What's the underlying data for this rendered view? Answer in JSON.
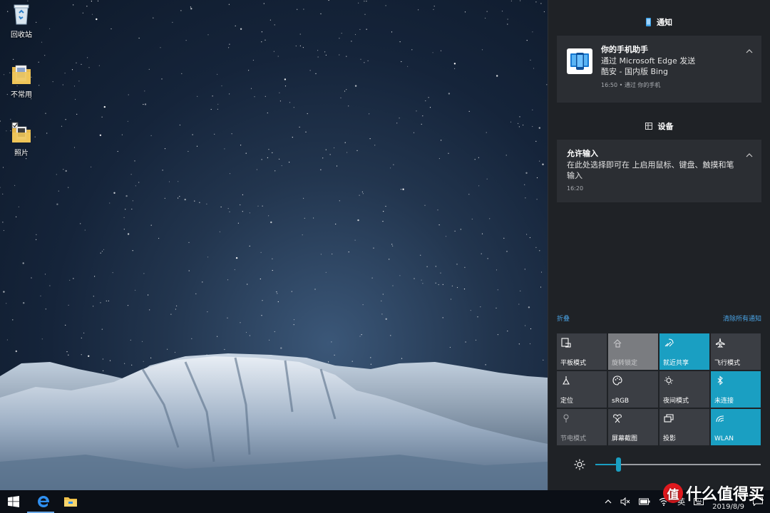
{
  "desktop": {
    "icons": [
      {
        "label": "回收站",
        "icon": "recycle-bin-icon"
      },
      {
        "label": "不常用",
        "icon": "folder-icon"
      },
      {
        "label": "照片",
        "icon": "folder-icon"
      }
    ]
  },
  "action_center": {
    "notifications_header": "通知",
    "devices_header": "设备",
    "phone_notification": {
      "title": "你的手机助手",
      "line1": "通过 Microsoft Edge 发送",
      "line2": "酷安 - 国内版 Bing",
      "meta": "16:50 • 通过 你的手机"
    },
    "device_notification": {
      "title": "允许输入",
      "body": "在此处选择即可在  上启用鼠标、键盘、触摸和笔输入",
      "time": "16:20"
    },
    "collapse_label": "折叠",
    "clear_all_label": "清除所有通知",
    "tiles": [
      {
        "label": "平板模式",
        "icon": "tablet-mode-icon",
        "state": "off"
      },
      {
        "label": "旋转锁定",
        "icon": "rotation-lock-icon",
        "state": "disabled"
      },
      {
        "label": "就近共享",
        "icon": "nearby-share-icon",
        "state": "on"
      },
      {
        "label": "飞行模式",
        "icon": "airplane-icon",
        "state": "off"
      },
      {
        "label": "定位",
        "icon": "location-icon",
        "state": "off"
      },
      {
        "label": "sRGB",
        "icon": "palette-icon",
        "state": "off"
      },
      {
        "label": "夜间模式",
        "icon": "night-light-icon",
        "state": "off"
      },
      {
        "label": "未连接",
        "icon": "bluetooth-icon",
        "state": "on"
      },
      {
        "label": "节电模式",
        "icon": "battery-saver-icon",
        "state": "faded"
      },
      {
        "label": "屏幕截图",
        "icon": "screen-snip-icon",
        "state": "off"
      },
      {
        "label": "投影",
        "icon": "project-icon",
        "state": "off"
      },
      {
        "label": "WLAN",
        "icon": "wifi-icon",
        "state": "on"
      }
    ],
    "brightness_level": 0.14
  },
  "taskbar": {
    "tray": {
      "ime_label": "英",
      "date": "2019/8/9"
    }
  },
  "watermark": {
    "badge": "值",
    "text": "什么值得买"
  },
  "colors": {
    "accent": "#1a9fc2",
    "link": "#4aa3e4",
    "panel_bg": "#1f2226",
    "card_bg": "#2b2e33",
    "tile_bg": "#3b3e44"
  }
}
